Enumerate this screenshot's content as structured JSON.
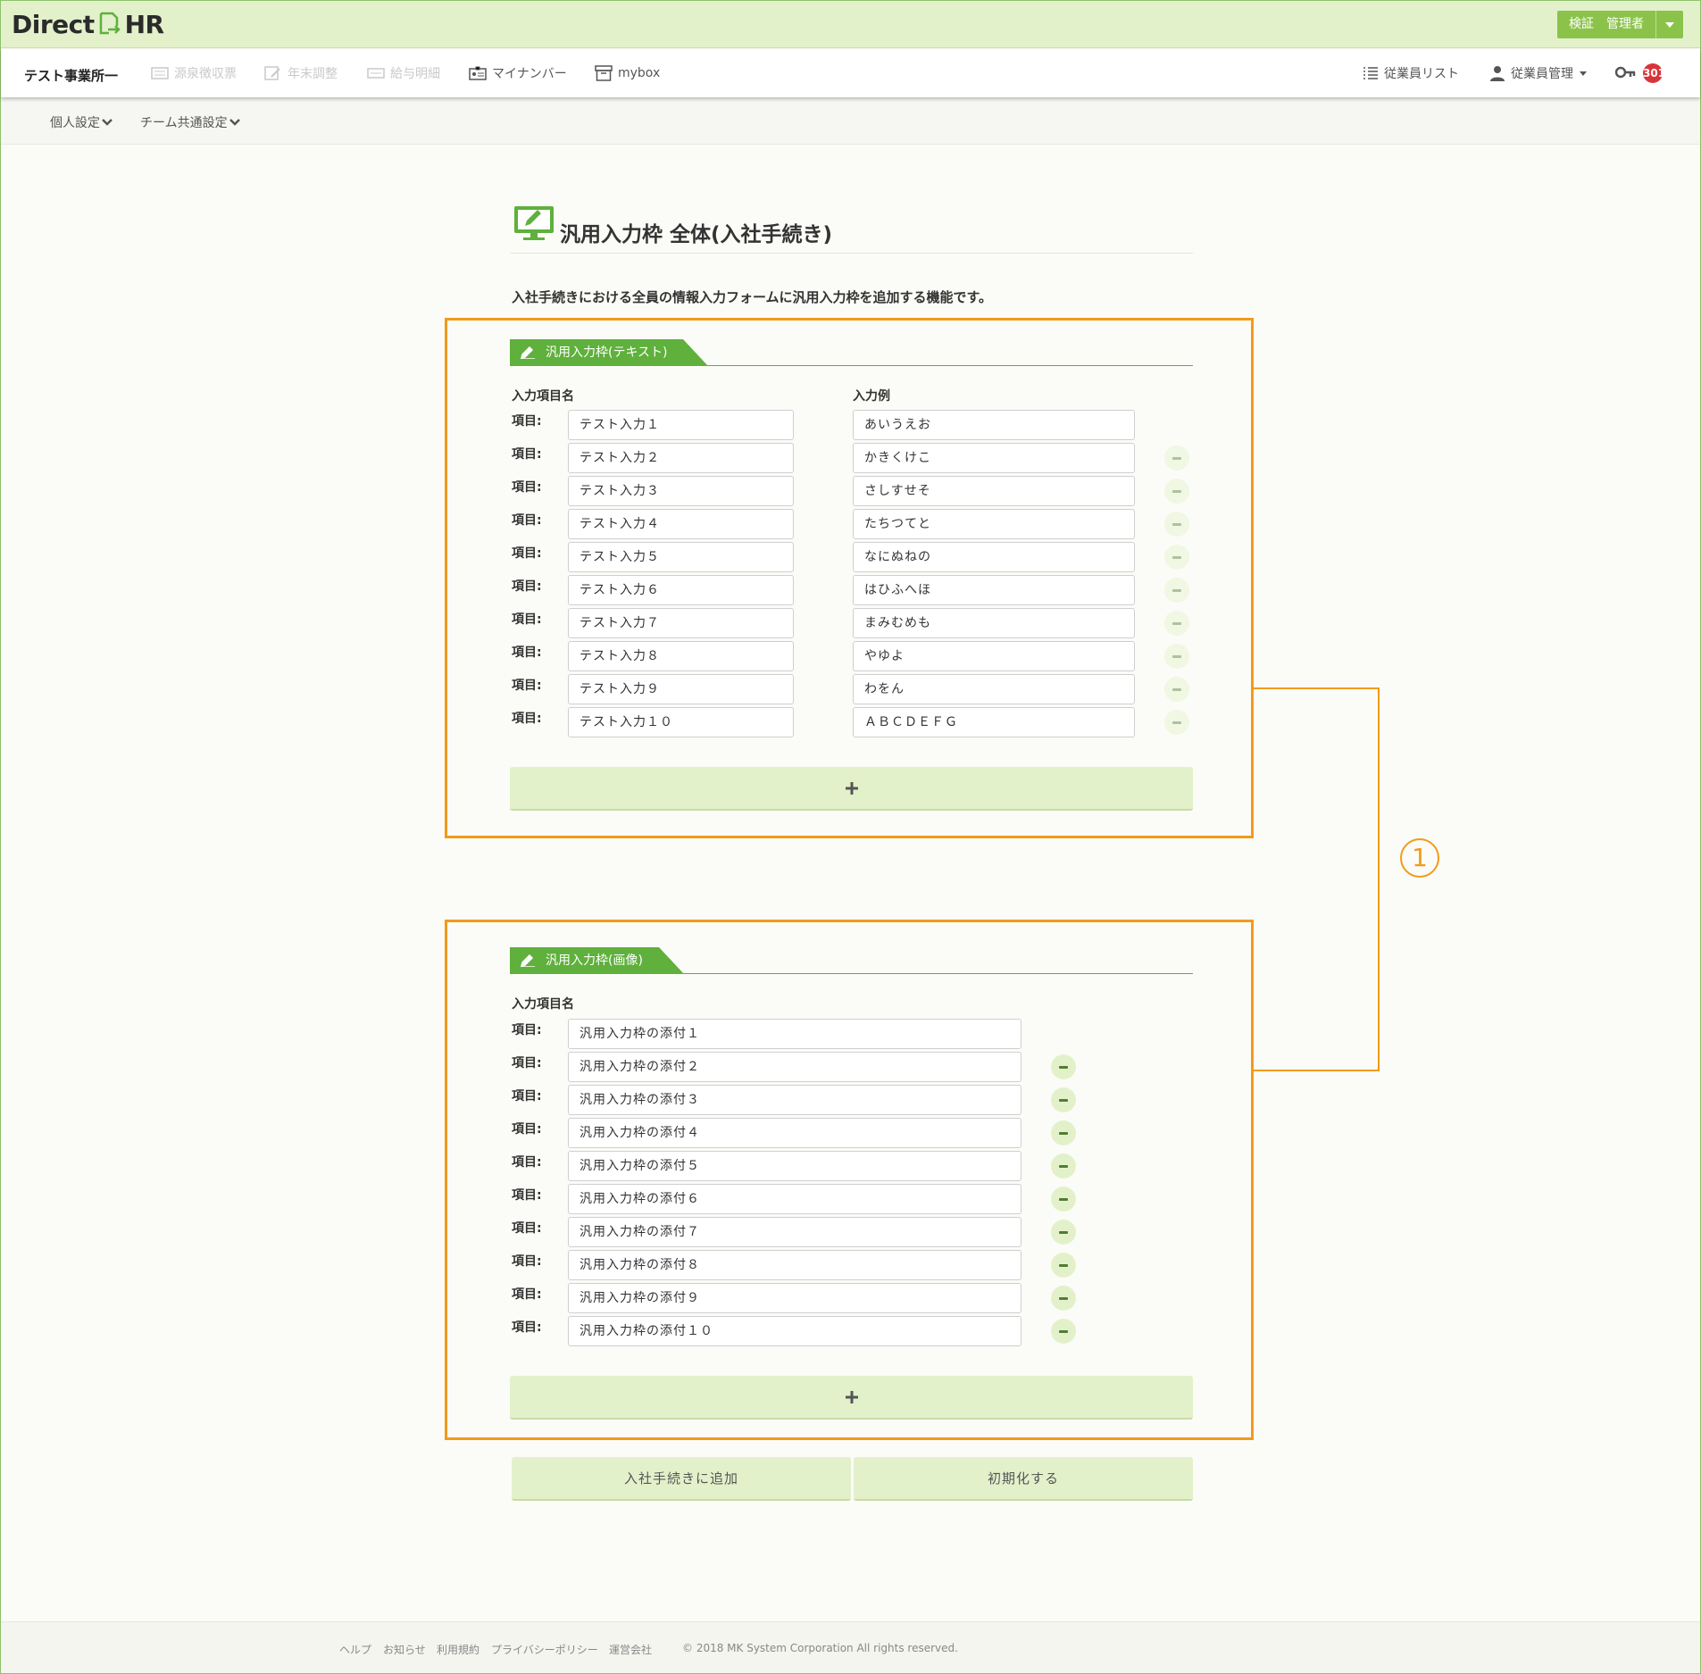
{
  "header": {
    "logo_left": "Direct",
    "logo_right": "HR",
    "user_label": "検証　管理者"
  },
  "nav": {
    "office": "テスト事業所一",
    "items": [
      "源泉徴収票",
      "年末調整",
      "給与明細",
      "マイナンバー",
      "mybox"
    ],
    "right_items": [
      "従業員リスト",
      "従業員管理"
    ],
    "badge_count": "301"
  },
  "subnav": {
    "items": [
      "個人設定",
      "チーム共通設定"
    ]
  },
  "page": {
    "title": "汎用入力枠 全体(入社手続き)",
    "description": "入社手続きにおける全員の情報入力フォームに汎用入力枠を追加する機能です。"
  },
  "callout": "1",
  "text_section": {
    "tab_label": "汎用入力枠(テキスト)",
    "col_name": "入力項目名",
    "col_example": "入力例",
    "row_label": "項目:",
    "rows": [
      {
        "name": "テスト入力１",
        "example": "あいうえお"
      },
      {
        "name": "テスト入力２",
        "example": "かきくけこ"
      },
      {
        "name": "テスト入力３",
        "example": "さしすせそ"
      },
      {
        "name": "テスト入力４",
        "example": "たちつてと"
      },
      {
        "name": "テスト入力５",
        "example": "なにぬねの"
      },
      {
        "name": "テスト入力６",
        "example": "はひふへほ"
      },
      {
        "name": "テスト入力７",
        "example": "まみむめも"
      },
      {
        "name": "テスト入力８",
        "example": "やゆよ"
      },
      {
        "name": "テスト入力９",
        "example": "わをん"
      },
      {
        "name": "テスト入力１０",
        "example": "ＡＢＣＤＥＦＧ"
      }
    ]
  },
  "image_section": {
    "tab_label": "汎用入力枠(画像)",
    "col_name": "入力項目名",
    "row_label": "項目:",
    "rows": [
      "汎用入力枠の添付１",
      "汎用入力枠の添付２",
      "汎用入力枠の添付３",
      "汎用入力枠の添付４",
      "汎用入力枠の添付５",
      "汎用入力枠の添付６",
      "汎用入力枠の添付７",
      "汎用入力枠の添付８",
      "汎用入力枠の添付９",
      "汎用入力枠の添付１０"
    ]
  },
  "actions": {
    "add_label": "入社手続きに追加",
    "reset_label": "初期化する"
  },
  "footer": {
    "links": [
      "ヘルプ",
      "お知らせ",
      "利用規約",
      "プライバシーポリシー",
      "運営会社"
    ],
    "copyright": "© 2018 MK System Corporation All rights reserved."
  },
  "colors": {
    "brand_green": "#8bc34a",
    "section_green": "#5fb03c",
    "highlight_orange": "#f29a1b",
    "button_bg": "#e3f1cb"
  },
  "icons": {
    "nav": [
      "receipt-icon",
      "year-end-icon",
      "payslip-icon",
      "id-card-icon",
      "box-icon"
    ],
    "right": [
      "list-icon",
      "user-icon",
      "key-icon"
    ]
  }
}
